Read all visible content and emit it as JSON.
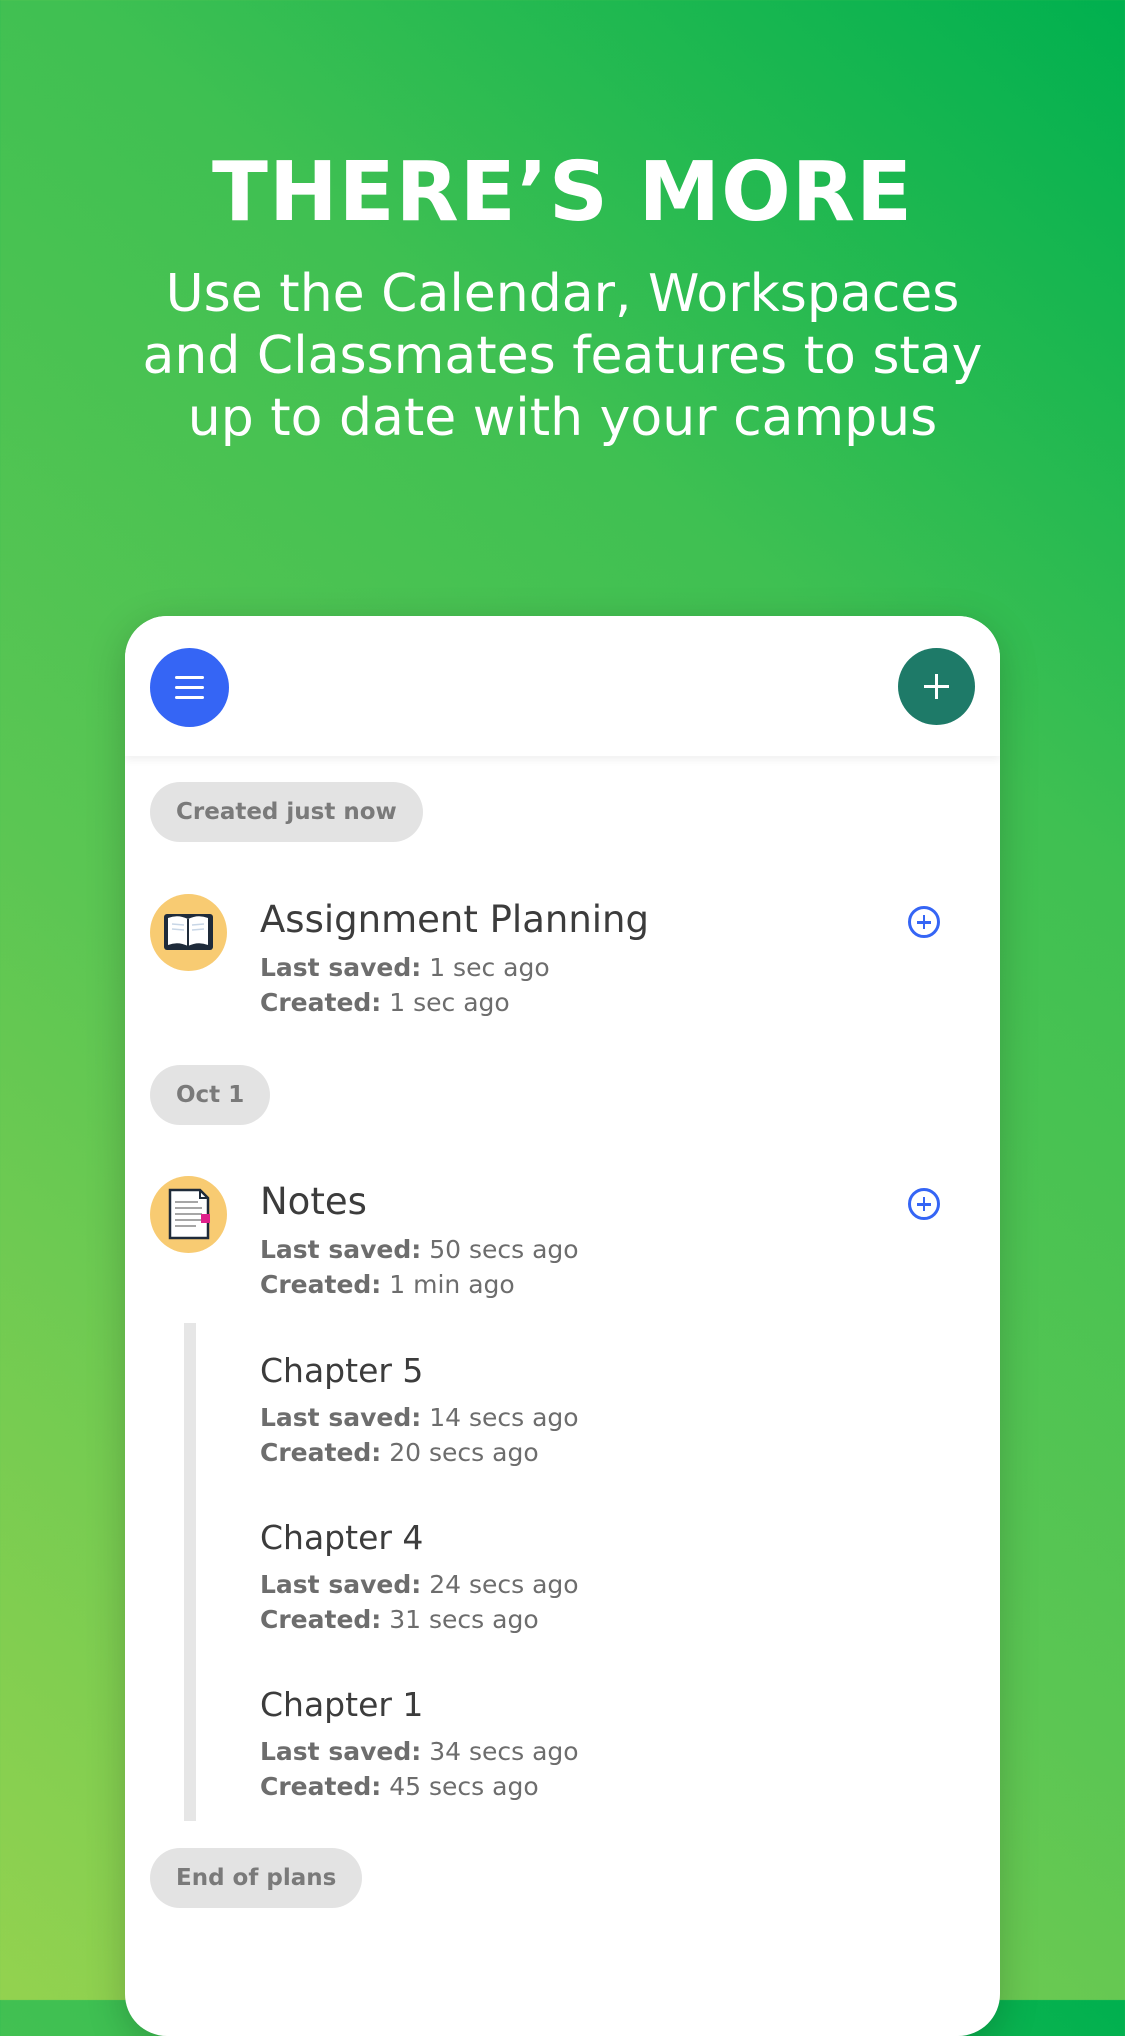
{
  "promo": {
    "headline": "THERE’S MORE",
    "subtitle": "Use the Calendar, Workspaces and Classmates features to stay up to date with your campus"
  },
  "app": {
    "header": {
      "menu_icon": "hamburger-menu-icon",
      "add_icon": "plus-icon"
    },
    "groups": [
      {
        "label": "Created just now",
        "plans": [
          {
            "title": "Assignment Planning",
            "icon": "open-book-icon",
            "last_saved_label": "Last saved:",
            "last_saved_value": "1 sec ago",
            "created_label": "Created:",
            "created_value": "1 sec ago"
          }
        ]
      },
      {
        "label": "Oct 1",
        "plans": [
          {
            "title": "Notes",
            "icon": "page-with-bookmark-icon",
            "last_saved_label": "Last saved:",
            "last_saved_value": "50 secs ago",
            "created_label": "Created:",
            "created_value": "1 min ago",
            "children": [
              {
                "title": "Chapter 5",
                "last_saved_label": "Last saved:",
                "last_saved_value": "14 secs ago",
                "created_label": "Created:",
                "created_value": "20 secs ago"
              },
              {
                "title": "Chapter 4",
                "last_saved_label": "Last saved:",
                "last_saved_value": "24 secs ago",
                "created_label": "Created:",
                "created_value": "31 secs ago"
              },
              {
                "title": "Chapter 1",
                "last_saved_label": "Last saved:",
                "last_saved_value": "34 secs ago",
                "created_label": "Created:",
                "created_value": "45 secs ago"
              }
            ]
          }
        ]
      }
    ],
    "end_label": "End of plans"
  },
  "colors": {
    "menu_button": "#3565f5",
    "add_button": "#1e7a68",
    "icon_circle": "#f8cb72",
    "pill_bg": "#e3e3e3",
    "accent": "#3565f5"
  }
}
